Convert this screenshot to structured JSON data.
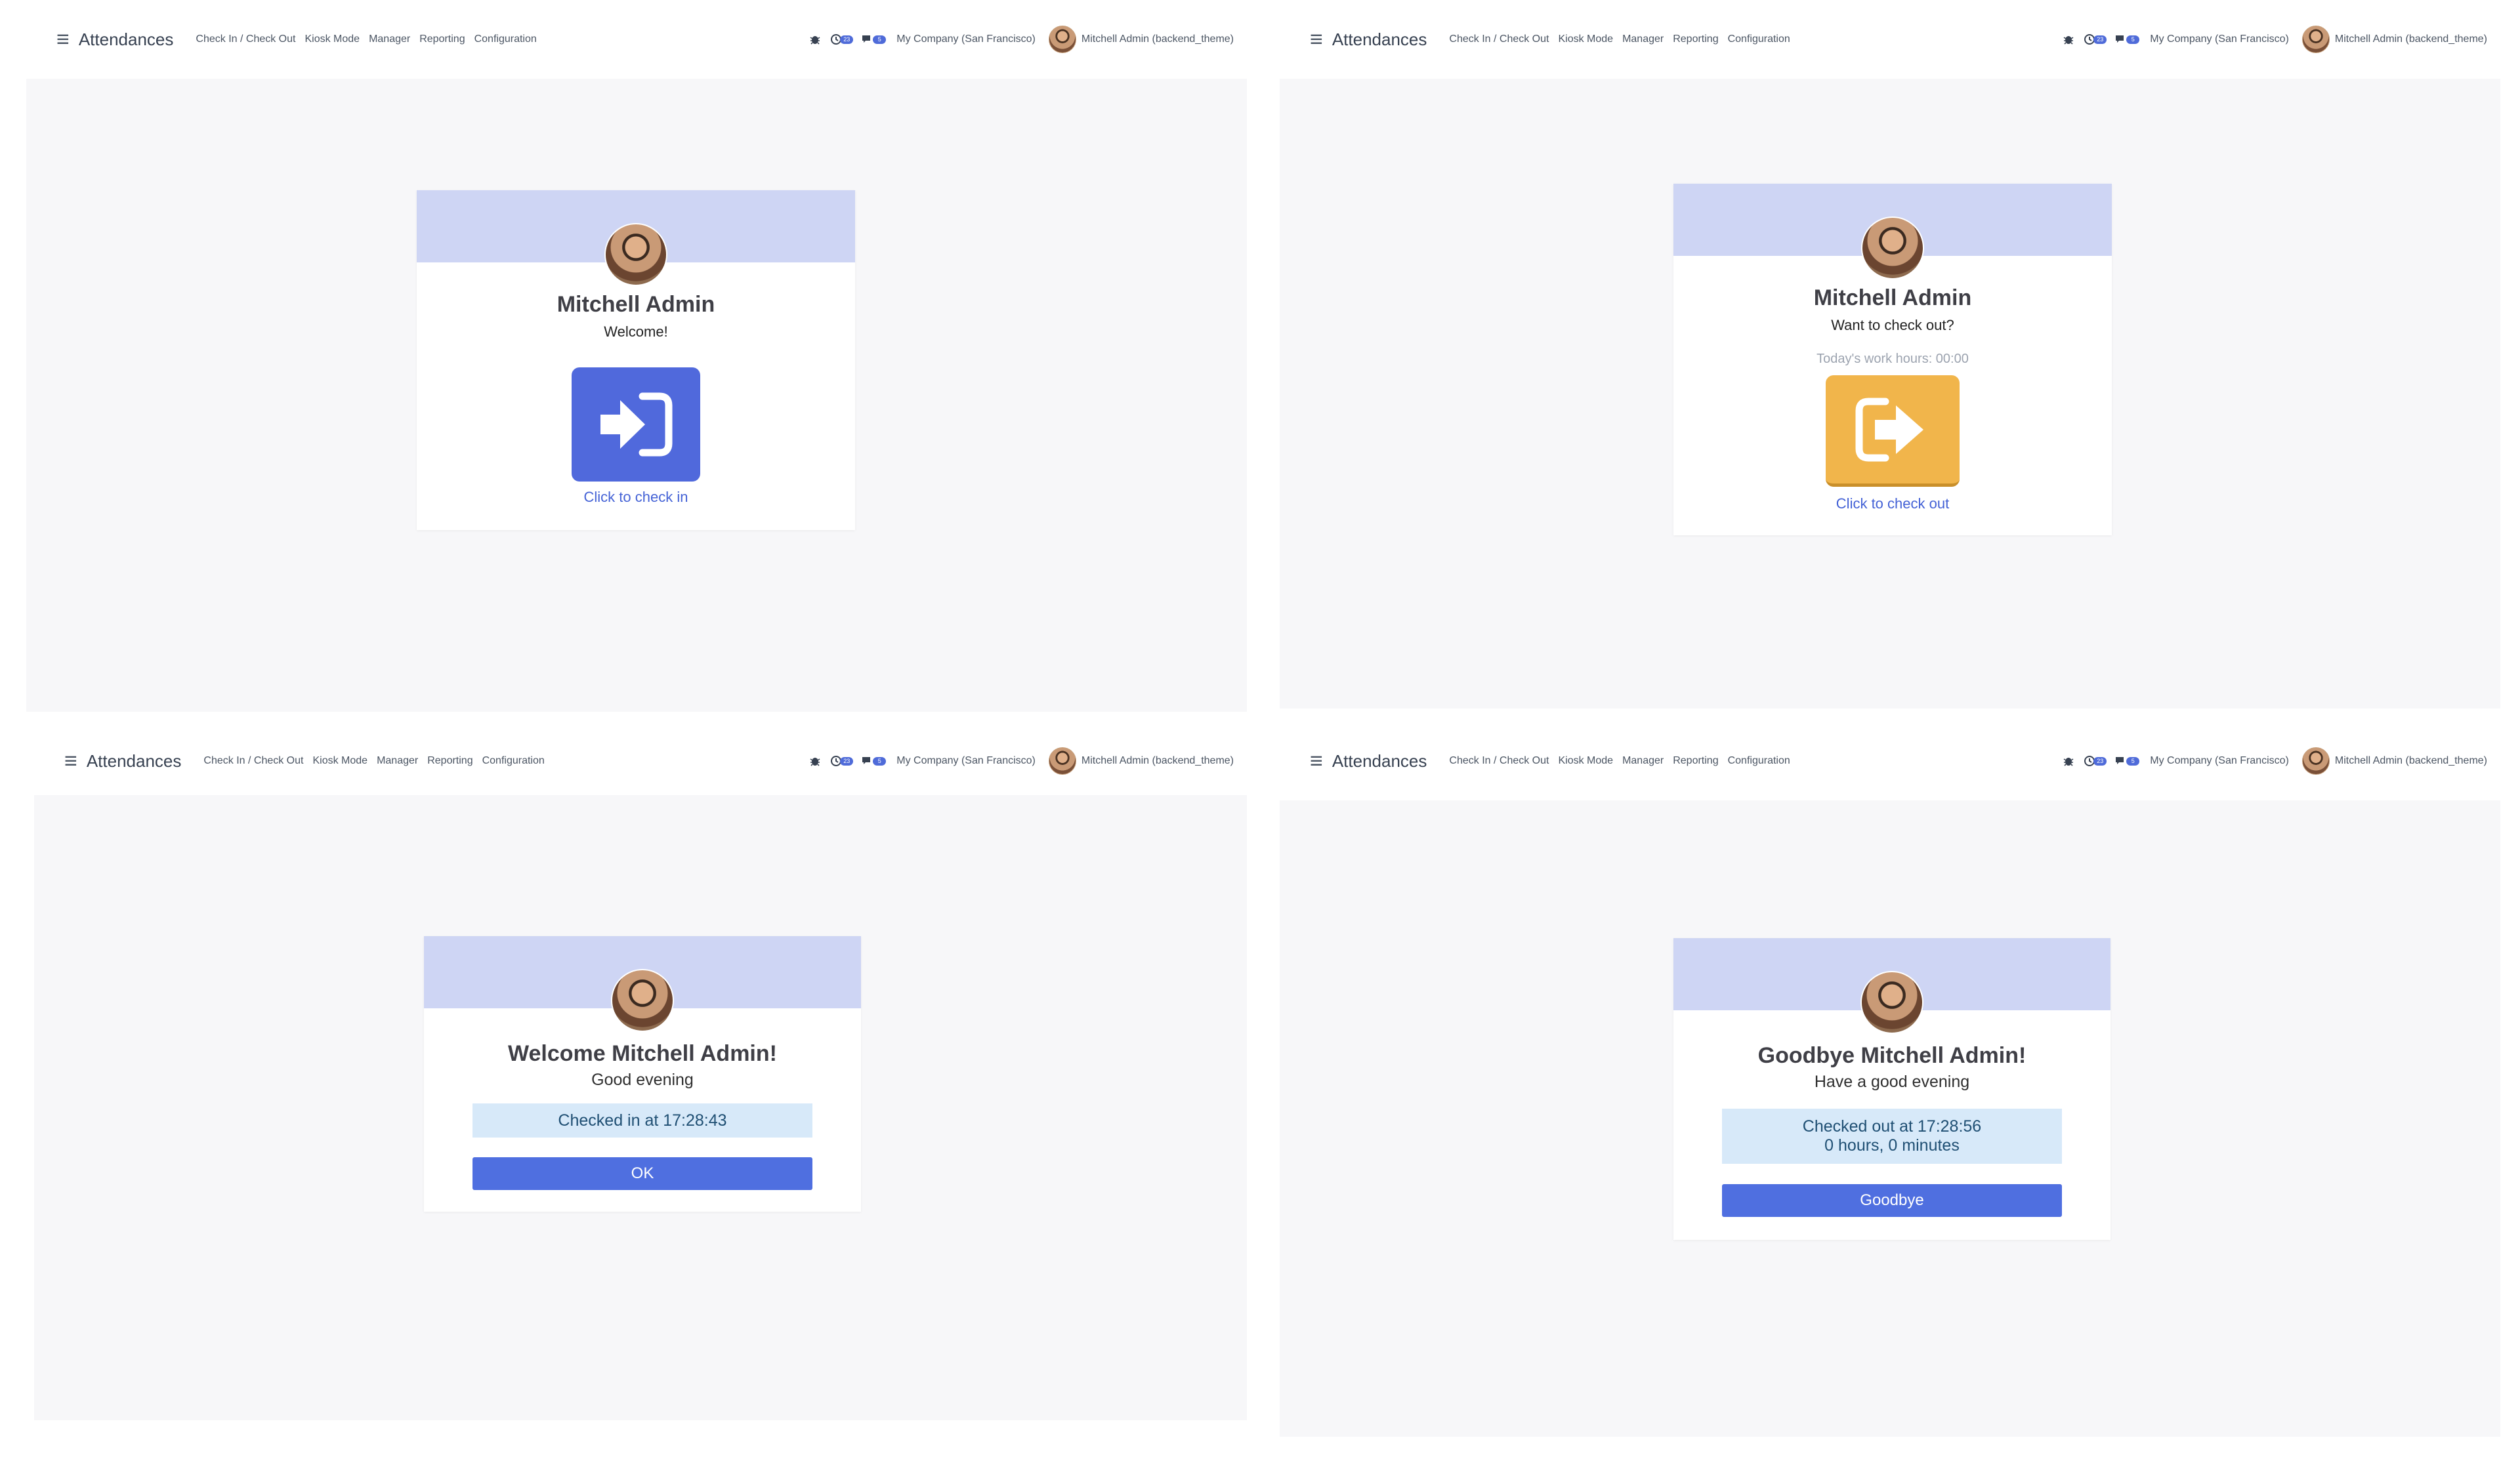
{
  "navbar": {
    "app_name": "Attendances",
    "menu": [
      "Check In / Check Out",
      "Kiosk Mode",
      "Manager",
      "Reporting",
      "Configuration"
    ],
    "company": "My Company (San Francisco)",
    "user": "Mitchell Admin (backend_theme)",
    "icons": [
      "bug-icon",
      "clock-activity-icon",
      "chat-icon"
    ],
    "badges": [
      "23",
      "5"
    ]
  },
  "employee": {
    "name": "Mitchell Admin"
  },
  "panels": {
    "check_in": {
      "greeting": "Welcome!",
      "button_caption": "Click to check in",
      "button_color": "#5069dc"
    },
    "check_out": {
      "greeting": "Want to check out?",
      "work_hours": "Today's work hours: 00:00",
      "button_caption": "Click to check out",
      "button_color": "#f1b54b"
    },
    "welcome": {
      "title": "Welcome Mitchell Admin!",
      "subtitle": "Good evening",
      "status": "Checked in at 17:28:43",
      "button": "OK"
    },
    "goodbye": {
      "title": "Goodbye Mitchell Admin!",
      "subtitle": "Have a good evening",
      "status_line1": "Checked out at 17:28:56",
      "status_line2": "0 hours, 0 minutes",
      "button": "Goodbye"
    }
  }
}
